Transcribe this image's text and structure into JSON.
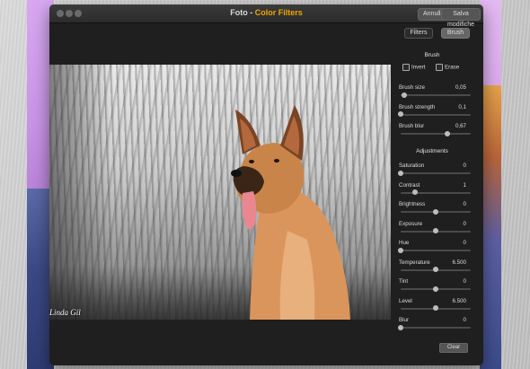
{
  "window": {
    "title_prefix": "Foto - ",
    "title_accent": "Color Filters",
    "cancel_label": "Annulla",
    "save_label": "Salva modifiche"
  },
  "tabs": {
    "filters": "Filters",
    "brush": "Brush"
  },
  "photo": {
    "watermark": "Linda Gil"
  },
  "brush": {
    "heading": "Brush",
    "invert_label": "Invert",
    "erase_label": "Erase",
    "sliders": [
      {
        "label": "Brush size",
        "value": "0,05",
        "level": 0.05
      },
      {
        "label": "Brush strength",
        "value": "0,1",
        "level": 0.0
      },
      {
        "label": "Brush blur",
        "value": "0,67",
        "level": 0.67
      }
    ]
  },
  "adjustments": {
    "heading": "Adjustments",
    "sliders": [
      {
        "label": "Saturation",
        "value": "0",
        "level": 0.0
      },
      {
        "label": "Contrast",
        "value": "1",
        "level": 0.2
      },
      {
        "label": "Brightness",
        "value": "0",
        "level": 0.5
      },
      {
        "label": "Exposure",
        "value": "0",
        "level": 0.5
      },
      {
        "label": "Hue",
        "value": "0",
        "level": 0.0
      },
      {
        "label": "Temperature",
        "value": "6.500",
        "level": 0.5
      },
      {
        "label": "Tint",
        "value": "0",
        "level": 0.5
      },
      {
        "label": "Level",
        "value": "6.500",
        "level": 0.5
      },
      {
        "label": "Blur",
        "value": "0",
        "level": 0.0
      }
    ],
    "clear_label": "Clear"
  },
  "colors": {
    "title_accent": "#f0a500",
    "window_bg": "#1f1f1f"
  }
}
